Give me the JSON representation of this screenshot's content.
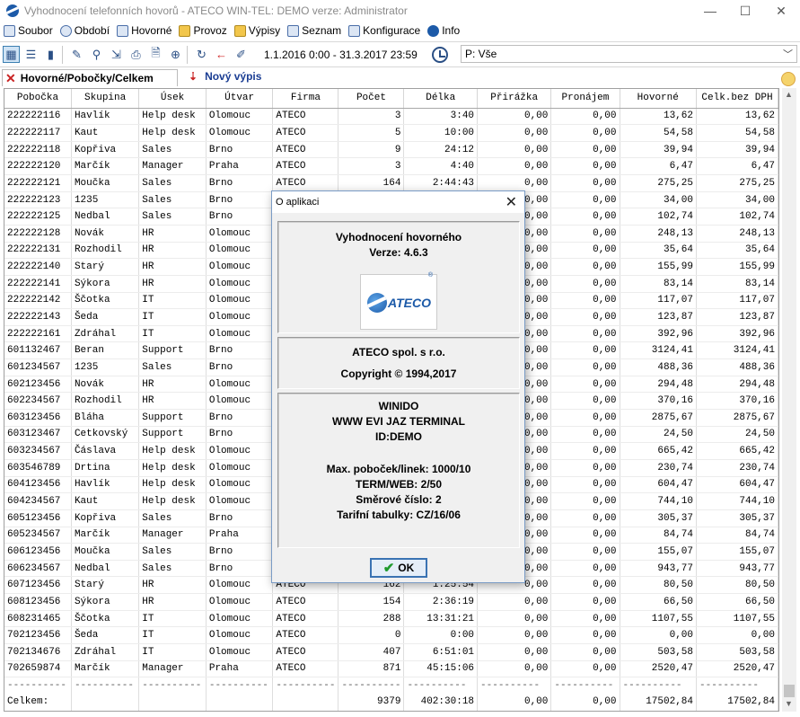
{
  "window": {
    "title": "Vyhodnocení telefonních hovorů - ATECO WIN-TEL: DEMO verze: Administrator",
    "min": "—",
    "max": "☐",
    "close": "✕"
  },
  "menu": [
    {
      "label": "Soubor",
      "icon": "file-icon"
    },
    {
      "label": "Období",
      "icon": "clock-icon"
    },
    {
      "label": "Hovorné",
      "icon": "table-icon"
    },
    {
      "label": "Provoz",
      "icon": "bell-icon"
    },
    {
      "label": "Výpisy",
      "icon": "report-icon"
    },
    {
      "label": "Seznam",
      "icon": "list-icon"
    },
    {
      "label": "Konfigurace",
      "icon": "config-icon"
    },
    {
      "label": "Info",
      "icon": "info-icon"
    }
  ],
  "toolbar": {
    "date_range": "1.1.2016 0:00 - 31.3.2017 23:59",
    "filter_value": "P: Vše"
  },
  "tabs": {
    "tab1": "Hovorné/Pobočky/Celkem",
    "tab2": "Nový výpis"
  },
  "table": {
    "headers": [
      "Pobočka",
      "Skupina",
      "Úsek",
      "Útvar",
      "Firma",
      "Počet",
      "Délka",
      "Přirážka",
      "Pronájem",
      "Hovorné",
      "Celk.bez DPH"
    ],
    "rows": [
      [
        "222222116",
        "Havlík",
        "Help desk",
        "Olomouc",
        "ATECO",
        "3",
        "3:40",
        "0,00",
        "0,00",
        "13,62",
        "13,62"
      ],
      [
        "222222117",
        "Kaut",
        "Help desk",
        "Olomouc",
        "ATECO",
        "5",
        "10:00",
        "0,00",
        "0,00",
        "54,58",
        "54,58"
      ],
      [
        "222222118",
        "Kopřiva",
        "Sales",
        "Brno",
        "ATECO",
        "9",
        "24:12",
        "0,00",
        "0,00",
        "39,94",
        "39,94"
      ],
      [
        "222222120",
        "Marčík",
        "Manager",
        "Praha",
        "ATECO",
        "3",
        "4:40",
        "0,00",
        "0,00",
        "6,47",
        "6,47"
      ],
      [
        "222222121",
        "Moučka",
        "Sales",
        "Brno",
        "ATECO",
        "164",
        "2:44:43",
        "0,00",
        "0,00",
        "275,25",
        "275,25"
      ],
      [
        "222222123",
        "1235",
        "Sales",
        "Brno",
        "",
        "",
        "",
        "0,00",
        "0,00",
        "34,00",
        "34,00"
      ],
      [
        "222222125",
        "Nedbal",
        "Sales",
        "Brno",
        "",
        "",
        "",
        "0,00",
        "0,00",
        "102,74",
        "102,74"
      ],
      [
        "222222128",
        "Novák",
        "HR",
        "Olomouc",
        "",
        "",
        "",
        "0,00",
        "0,00",
        "248,13",
        "248,13"
      ],
      [
        "222222131",
        "Rozhodil",
        "HR",
        "Olomouc",
        "",
        "",
        "",
        "0,00",
        "0,00",
        "35,64",
        "35,64"
      ],
      [
        "222222140",
        "Starý",
        "HR",
        "Olomouc",
        "",
        "",
        "",
        "0,00",
        "0,00",
        "155,99",
        "155,99"
      ],
      [
        "222222141",
        "Sýkora",
        "HR",
        "Olomouc",
        "",
        "",
        "",
        "0,00",
        "0,00",
        "83,14",
        "83,14"
      ],
      [
        "222222142",
        "Ščotka",
        "IT",
        "Olomouc",
        "",
        "",
        "",
        "0,00",
        "0,00",
        "117,07",
        "117,07"
      ],
      [
        "222222143",
        "Šeda",
        "IT",
        "Olomouc",
        "",
        "",
        "",
        "0,00",
        "0,00",
        "123,87",
        "123,87"
      ],
      [
        "222222161",
        "Zdráhal",
        "IT",
        "Olomouc",
        "",
        "",
        "",
        "0,00",
        "0,00",
        "392,96",
        "392,96"
      ],
      [
        "601132467",
        "Beran",
        "Support",
        "Brno",
        "",
        "",
        "",
        "0,00",
        "0,00",
        "3124,41",
        "3124,41"
      ],
      [
        "601234567",
        "1235",
        "Sales",
        "Brno",
        "",
        "",
        "",
        "0,00",
        "0,00",
        "488,36",
        "488,36"
      ],
      [
        "602123456",
        "Novák",
        "HR",
        "Olomouc",
        "",
        "",
        "",
        "0,00",
        "0,00",
        "294,48",
        "294,48"
      ],
      [
        "602234567",
        "Rozhodil",
        "HR",
        "Olomouc",
        "",
        "",
        "",
        "0,00",
        "0,00",
        "370,16",
        "370,16"
      ],
      [
        "603123456",
        "Bláha",
        "Support",
        "Brno",
        "",
        "",
        "",
        "0,00",
        "0,00",
        "2875,67",
        "2875,67"
      ],
      [
        "603123467",
        "Cetkovský",
        "Support",
        "Brno",
        "",
        "",
        "",
        "0,00",
        "0,00",
        "24,50",
        "24,50"
      ],
      [
        "603234567",
        "Čáslava",
        "Help desk",
        "Olomouc",
        "",
        "",
        "",
        "0,00",
        "0,00",
        "665,42",
        "665,42"
      ],
      [
        "603546789",
        "Drtina",
        "Help desk",
        "Olomouc",
        "",
        "",
        "",
        "0,00",
        "0,00",
        "230,74",
        "230,74"
      ],
      [
        "604123456",
        "Havlík",
        "Help desk",
        "Olomouc",
        "",
        "",
        "",
        "0,00",
        "0,00",
        "604,47",
        "604,47"
      ],
      [
        "604234567",
        "Kaut",
        "Help desk",
        "Olomouc",
        "",
        "",
        "",
        "0,00",
        "0,00",
        "744,10",
        "744,10"
      ],
      [
        "605123456",
        "Kopřiva",
        "Sales",
        "Brno",
        "",
        "",
        "",
        "0,00",
        "0,00",
        "305,37",
        "305,37"
      ],
      [
        "605234567",
        "Marčík",
        "Manager",
        "Praha",
        "",
        "",
        "",
        "0,00",
        "0,00",
        "84,74",
        "84,74"
      ],
      [
        "606123456",
        "Moučka",
        "Sales",
        "Brno",
        "",
        "",
        "",
        "0,00",
        "0,00",
        "155,07",
        "155,07"
      ],
      [
        "606234567",
        "Nedbal",
        "Sales",
        "Brno",
        "",
        "",
        "",
        "0,00",
        "0,00",
        "943,77",
        "943,77"
      ],
      [
        "607123456",
        "Starý",
        "HR",
        "Olomouc",
        "ATECO",
        "162",
        "1:25:54",
        "0,00",
        "0,00",
        "80,50",
        "80,50"
      ],
      [
        "608123456",
        "Sýkora",
        "HR",
        "Olomouc",
        "ATECO",
        "154",
        "2:36:19",
        "0,00",
        "0,00",
        "66,50",
        "66,50"
      ],
      [
        "608231465",
        "Ščotka",
        "IT",
        "Olomouc",
        "ATECO",
        "288",
        "13:31:21",
        "0,00",
        "0,00",
        "1107,55",
        "1107,55"
      ],
      [
        "702123456",
        "Šeda",
        "IT",
        "Olomouc",
        "ATECO",
        "0",
        "0:00",
        "0,00",
        "0,00",
        "0,00",
        "0,00"
      ],
      [
        "702134676",
        "Zdráhal",
        "IT",
        "Olomouc",
        "ATECO",
        "407",
        "6:51:01",
        "0,00",
        "0,00",
        "503,58",
        "503,58"
      ],
      [
        "702659874",
        "Marčík",
        "Manager",
        "Praha",
        "ATECO",
        "871",
        "45:15:06",
        "0,00",
        "0,00",
        "2520,47",
        "2520,47"
      ]
    ],
    "separator": "----------",
    "total": [
      "Celkem:",
      "",
      "",
      "",
      "",
      "9379",
      "402:30:18",
      "0,00",
      "0,00",
      "17502,84",
      "17502,84"
    ]
  },
  "dialog": {
    "title": "O aplikaci",
    "close": "✕",
    "app_name": "Vyhodnocení hovorného",
    "version": "Verze: 4.6.3",
    "logo_text": "ATECO",
    "logo_reg": "®",
    "company": "ATECO  spol. s r.o.",
    "copyright": "Copyright © 1994,2017",
    "info_lines": [
      "WINIDO",
      "WWW EVI JAZ TERMINAL",
      "ID:DEMO"
    ],
    "spec_lines": [
      "Max. poboček/linek: 1000/10",
      "TERM/WEB: 2/50",
      "Směrové číslo: 2",
      "Tarifní tabulky: CZ/16/06"
    ],
    "ok": "OK"
  }
}
